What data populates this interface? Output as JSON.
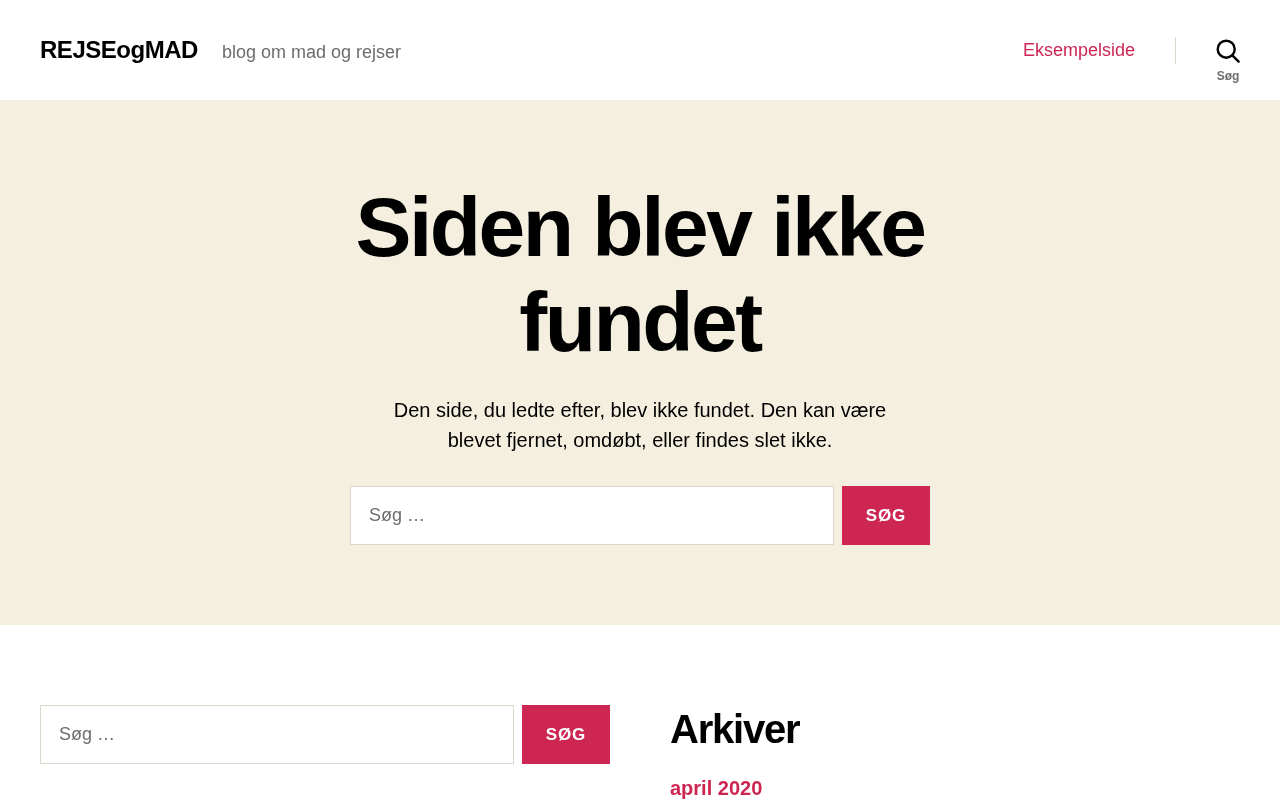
{
  "header": {
    "site_title": "REJSEogMAD",
    "tagline": "blog om mad og rejser",
    "menu": [
      {
        "label": "Eksempelside"
      }
    ],
    "search_toggle": {
      "label": "Søg"
    }
  },
  "hero": {
    "title": "Siden blev ikke fundet",
    "message": "Den side, du ledte efter, blev ikke fundet. Den kan være blevet fjernet, omdøbt, eller findes slet ikke.",
    "search": {
      "placeholder": "Søg …",
      "button": "SØG"
    }
  },
  "widgets": {
    "search": {
      "placeholder": "Søg …",
      "button": "SØG"
    },
    "archives": {
      "title": "Arkiver",
      "items": [
        {
          "label": "april 2020"
        }
      ]
    }
  }
}
